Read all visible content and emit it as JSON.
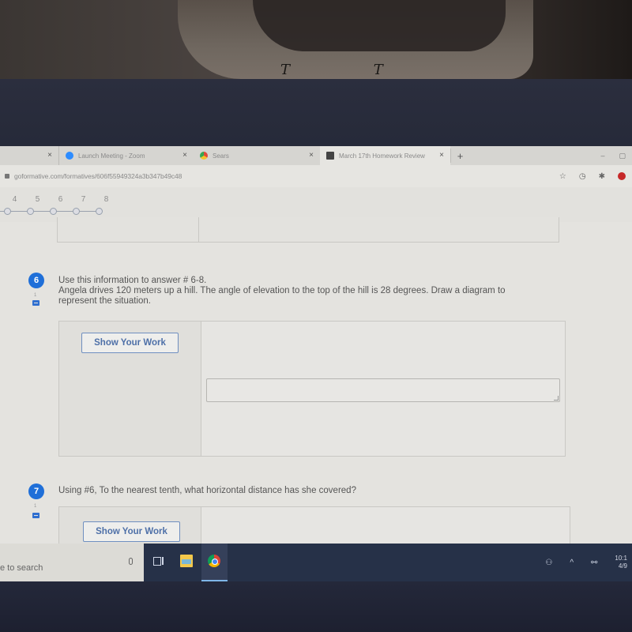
{
  "browser": {
    "tabs": [
      {
        "label": "",
        "icon": "blank-tab-icon",
        "active": false
      },
      {
        "label": "Launch Meeting - Zoom",
        "icon": "zoom-icon",
        "active": false
      },
      {
        "label": "Sears",
        "icon": "sears-icon",
        "active": false
      },
      {
        "label": "March 17th Homework Review",
        "icon": "classroom-icon",
        "active": true
      }
    ],
    "new_tab_label": "+",
    "close_glyph": "×",
    "url": "goformative.com/formatives/606f55949324a3b347b49c48",
    "window_controls": {
      "minimize": "–",
      "restore": "▢"
    },
    "addr_icons": {
      "star": "☆",
      "history": "◷",
      "extensions": "✱"
    }
  },
  "question_nav": {
    "numbers": [
      "4",
      "5",
      "6",
      "7",
      "8"
    ]
  },
  "questions": [
    {
      "number": "6",
      "points": "1",
      "lines": [
        "Use this information to answer # 6-8.",
        "Angela drives 120 meters up a hill.  The angle of elevation to the top of the hill is 28 degrees.  Draw a diagram to",
        "represent the situation."
      ],
      "show_work_label": "Show Your Work",
      "answer_value": ""
    },
    {
      "number": "7",
      "points": "1",
      "lines": [
        "Using #6, To the nearest tenth, what horizontal distance has she covered?"
      ],
      "show_work_label": "Show Your Work"
    }
  ],
  "taskbar": {
    "search_placeholder": "e to search",
    "clock_time": "10:1",
    "clock_date": "4/9",
    "tray_icons": [
      "people-icon",
      "chevron-up-icon",
      "network-icon"
    ]
  },
  "colors": {
    "accent": "#1f6fd8",
    "button_text": "#4e70a8",
    "taskbar": "#263148"
  }
}
